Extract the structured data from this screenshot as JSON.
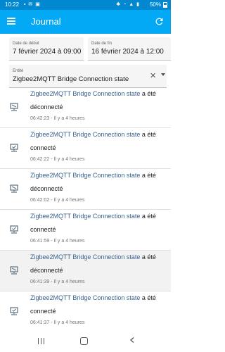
{
  "status_bar": {
    "time": "10:22",
    "battery": "50%"
  },
  "app_bar": {
    "title": "Journal"
  },
  "filters": {
    "start_label": "Date de début",
    "start_value": "7 février 2024 à 09:00",
    "end_label": "Date de fin",
    "end_value": "16 février 2024 à 12:00",
    "entity_label": "Entité",
    "entity_value": "Zigbee2MQTT Bridge Connection state"
  },
  "entries": [
    {
      "entity": "Zigbee2MQTT Bridge Connection state",
      "suffix": " a été",
      "state": "déconnecté",
      "meta": "06:42:23 - Il y a 4 heures",
      "icon": "lan-disconnect-icon"
    },
    {
      "entity": "Zigbee2MQTT Bridge Connection state",
      "suffix": " a été",
      "state": "connecté",
      "meta": "06:42:22 - Il y a 4 heures",
      "icon": "lan-connect-icon"
    },
    {
      "entity": "Zigbee2MQTT Bridge Connection state",
      "suffix": " a été",
      "state": "déconnecté",
      "meta": "06:42:02 - Il y a 4 heures",
      "icon": "lan-disconnect-icon"
    },
    {
      "entity": "Zigbee2MQTT Bridge Connection state",
      "suffix": " a été",
      "state": "connecté",
      "meta": "06:41:59 - Il y a 4 heures",
      "icon": "lan-connect-icon"
    },
    {
      "entity": "Zigbee2MQTT Bridge Connection state",
      "suffix": " a été",
      "state": "déconnecté",
      "meta": "06:41:39 - Il y a 4 heures",
      "icon": "lan-disconnect-icon"
    },
    {
      "entity": "Zigbee2MQTT Bridge Connection state",
      "suffix": " a été",
      "state": "connecté",
      "meta": "06:41:37 - Il y a 4 heures",
      "icon": "lan-connect-icon"
    }
  ],
  "colors": {
    "app_bar": "#03a9f4",
    "status_bar": "#0288d1",
    "entity_link": "#39638f"
  }
}
